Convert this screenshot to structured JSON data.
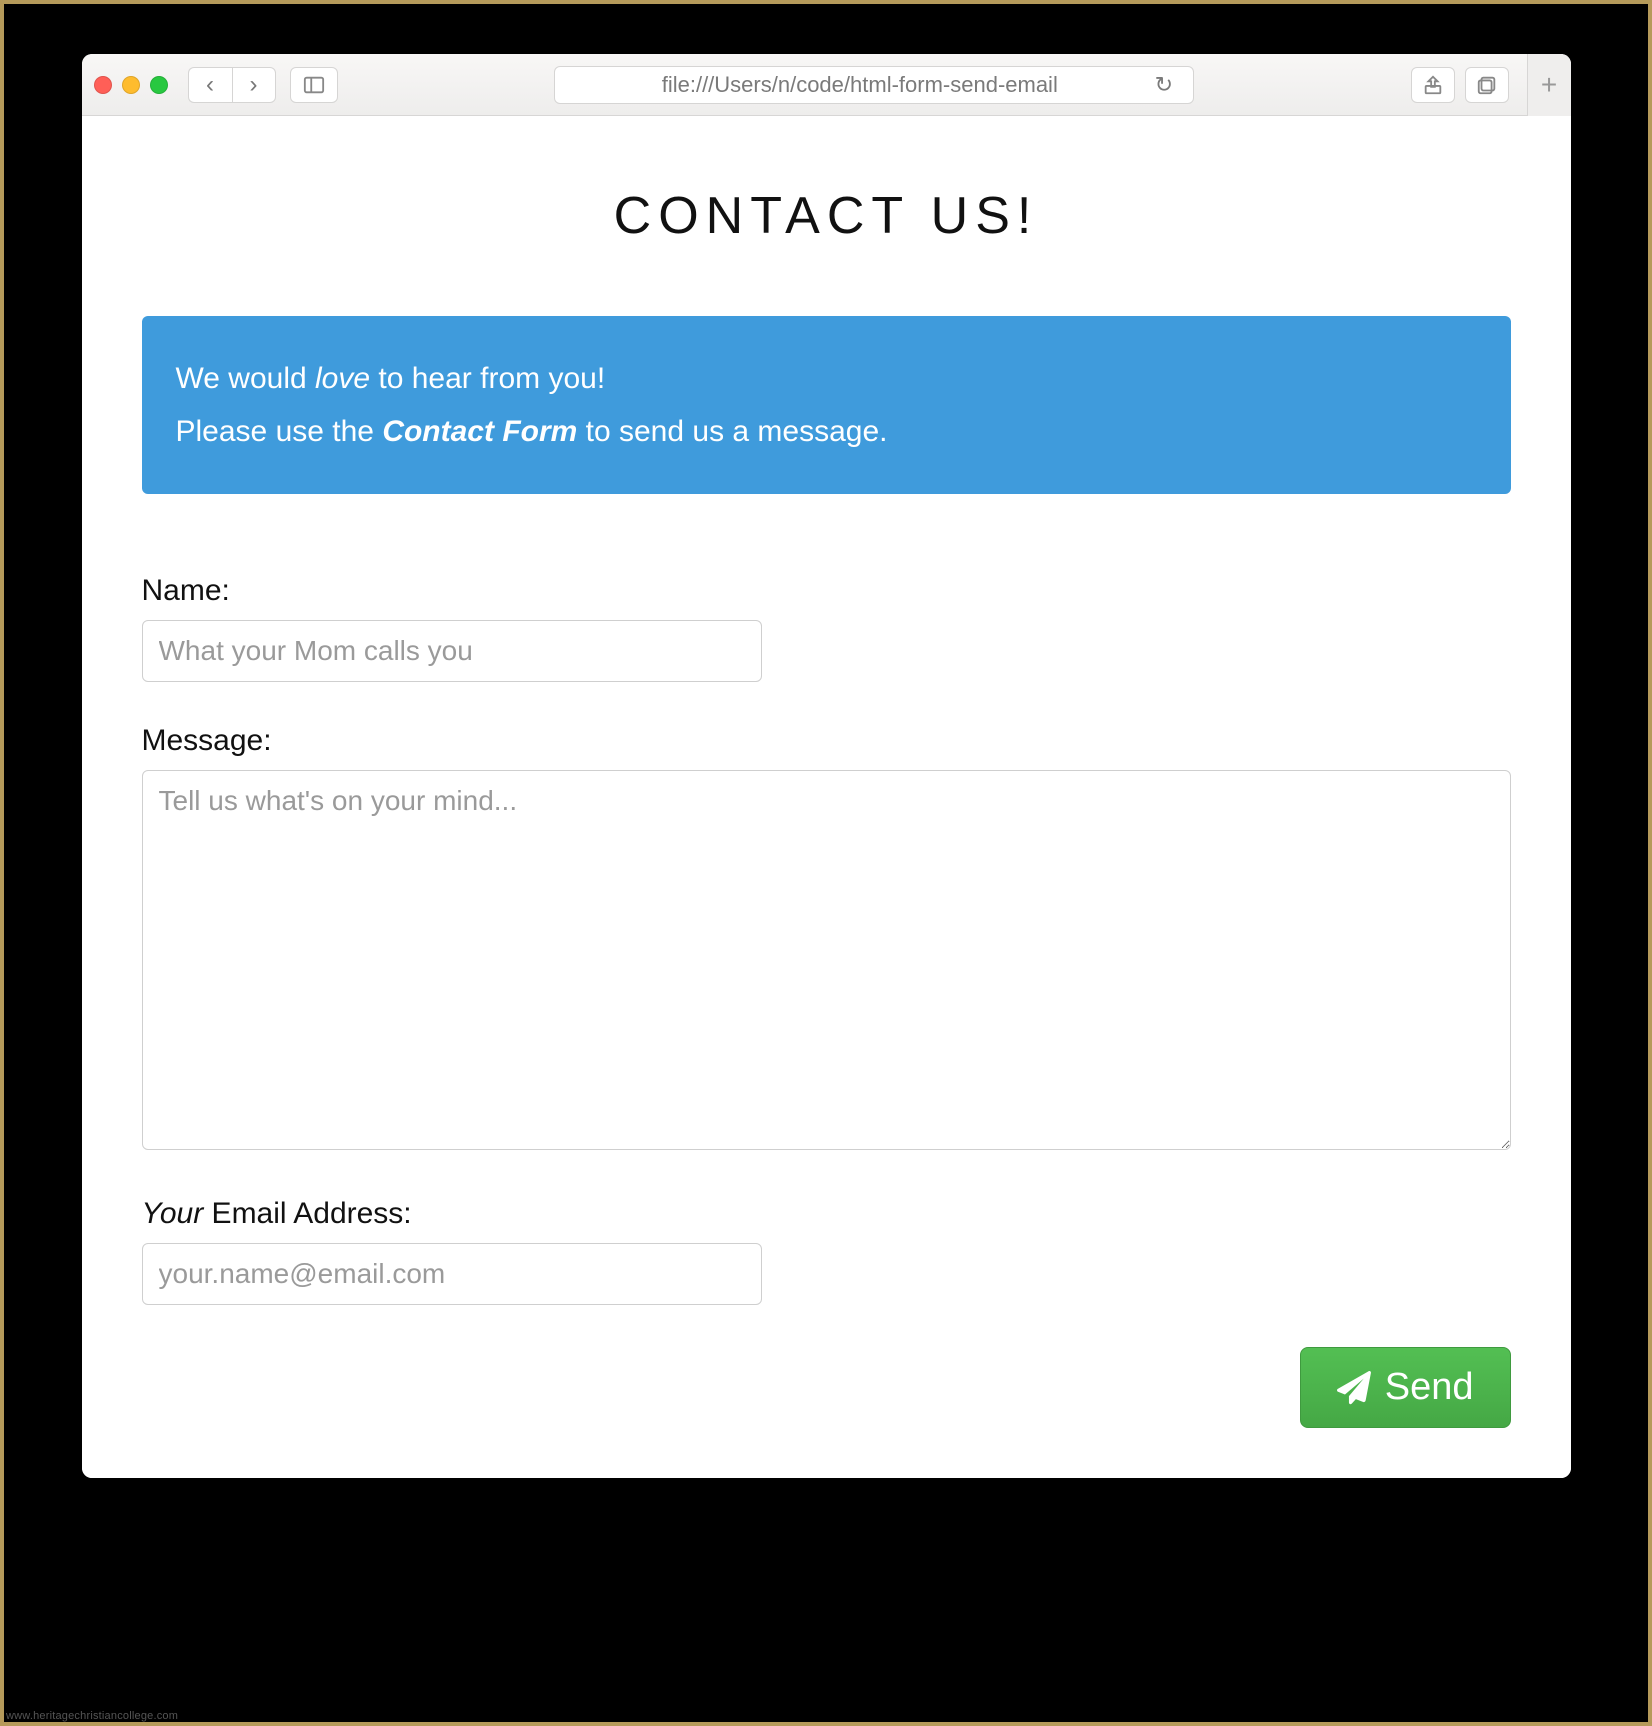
{
  "browser": {
    "url": "file:///Users/n/code/html-form-send-email"
  },
  "page": {
    "title": "CONTACT US!",
    "banner": {
      "line1_pre": "We would ",
      "line1_em": "love",
      "line1_post": " to hear from you!",
      "line2_pre": "Please use the ",
      "line2_strong": "Contact Form",
      "line2_post": " to send us a message."
    },
    "form": {
      "name": {
        "label": "Name:",
        "placeholder": "What your Mom calls you",
        "value": ""
      },
      "message": {
        "label": "Message:",
        "placeholder": "Tell us what's on your mind...",
        "value": ""
      },
      "email": {
        "label_em": "Your",
        "label_rest": " Email Address:",
        "placeholder": "your.name@email.com",
        "value": ""
      },
      "send_label": "Send"
    }
  },
  "watermark": "www.heritagechristiancollege.com"
}
